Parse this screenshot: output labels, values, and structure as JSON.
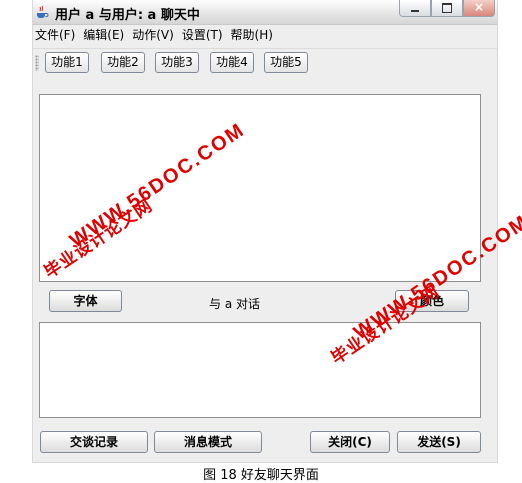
{
  "window": {
    "title": "用户  a  与用户: a 聊天中"
  },
  "menu": [
    "文件(F)",
    "编辑(E)",
    "动作(V)",
    "设置(T)",
    "帮助(H)"
  ],
  "toolbar": [
    "功能1",
    "功能2",
    "功能3",
    "功能4",
    "功能5"
  ],
  "font_button": "字体",
  "dialog_label": "与 a 对话",
  "color_button": "颜色",
  "bottom_buttons": {
    "history": "交谈记录",
    "mode": "消息模式",
    "close": "关闭(C)",
    "send": "发送(S)"
  },
  "watermarks": {
    "url": "WWW.56DOC.COM",
    "site": "毕业设计论文网"
  },
  "caption": "图 18  好友聊天界面",
  "colors": {
    "watermark": "#e00000"
  }
}
